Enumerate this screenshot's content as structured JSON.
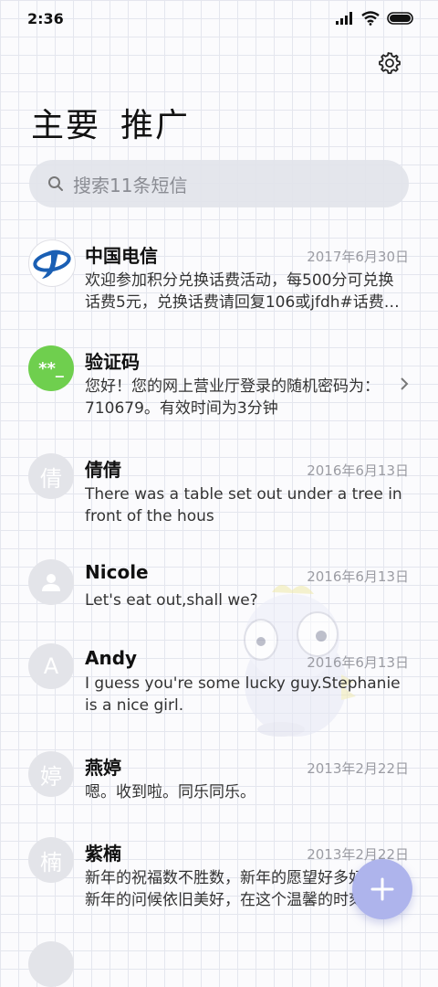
{
  "status_bar": {
    "time": "2:36"
  },
  "tabs": [
    {
      "label": "主要",
      "selected": true
    },
    {
      "label": "推广",
      "selected": false
    }
  ],
  "search": {
    "placeholder": "搜索11条短信"
  },
  "conversations": [
    {
      "name": "中国电信",
      "date": "2017年6月30日",
      "preview": "欢迎参加积分兑换话费活动，每500分可兑换话费5元，兑换话费请回复106或jfdh#话费…",
      "avatar_icon": "china-telecom-logo"
    },
    {
      "name": "验证码",
      "date": "",
      "preview": "您好！您的网上营业厅登录的随机密码为：710679。有效时间为3分钟",
      "avatar_text": "**_",
      "avatar_color": "#6fcf4e"
    },
    {
      "name": "倩倩",
      "date": "2016年6月13日",
      "preview": "There was a table set out under a tree in front of the hous",
      "avatar_text": "倩"
    },
    {
      "name": "Nicole",
      "date": "2016年6月13日",
      "preview": "Let's eat out,shall we?",
      "avatar_icon": "person-icon"
    },
    {
      "name": "Andy",
      "date": "2016年6月13日",
      "preview": "I guess you're some lucky guy.Stephanie is a nice girl.",
      "avatar_text": "A"
    },
    {
      "name": "燕婷",
      "date": "2013年2月22日",
      "preview": "嗯。收到啦。同乐同乐。",
      "avatar_text": "婷"
    },
    {
      "name": "紫楠",
      "date": "2013年2月22日",
      "preview": "新年的祝福数不胜数，新年的愿望好多好多，新年的问候依旧美好，在这个温馨的时刻",
      "avatar_text": "楠"
    }
  ],
  "fab": {
    "icon": "plus-icon",
    "color": "#aeb4ec"
  },
  "colors": {
    "grid_line": "#e4e6ee",
    "avatar_gray": "#e3e4e9",
    "telecom_blue": "#1a5fb4"
  }
}
